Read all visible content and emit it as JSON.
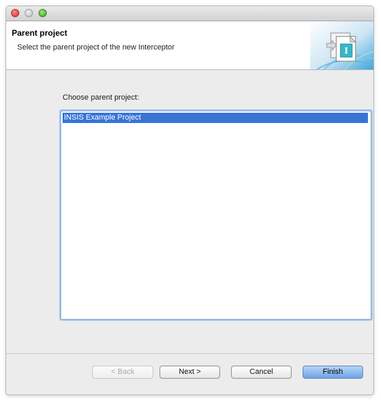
{
  "window": {
    "controls": [
      "close",
      "minimize",
      "zoom"
    ]
  },
  "header": {
    "title": "Parent project",
    "description": "Select the parent project of the new Interceptor",
    "banner_icon": "interceptor-wizard-icon"
  },
  "main": {
    "prompt": "Choose parent project:",
    "projects": [
      {
        "label": "INSIS Example Project",
        "selected": true
      }
    ]
  },
  "buttons": {
    "back": "< Back",
    "next": "Next >",
    "cancel": "Cancel",
    "finish": "Finish"
  },
  "colors": {
    "selection": "#3875d7",
    "default_button": "#6ea4e6"
  }
}
